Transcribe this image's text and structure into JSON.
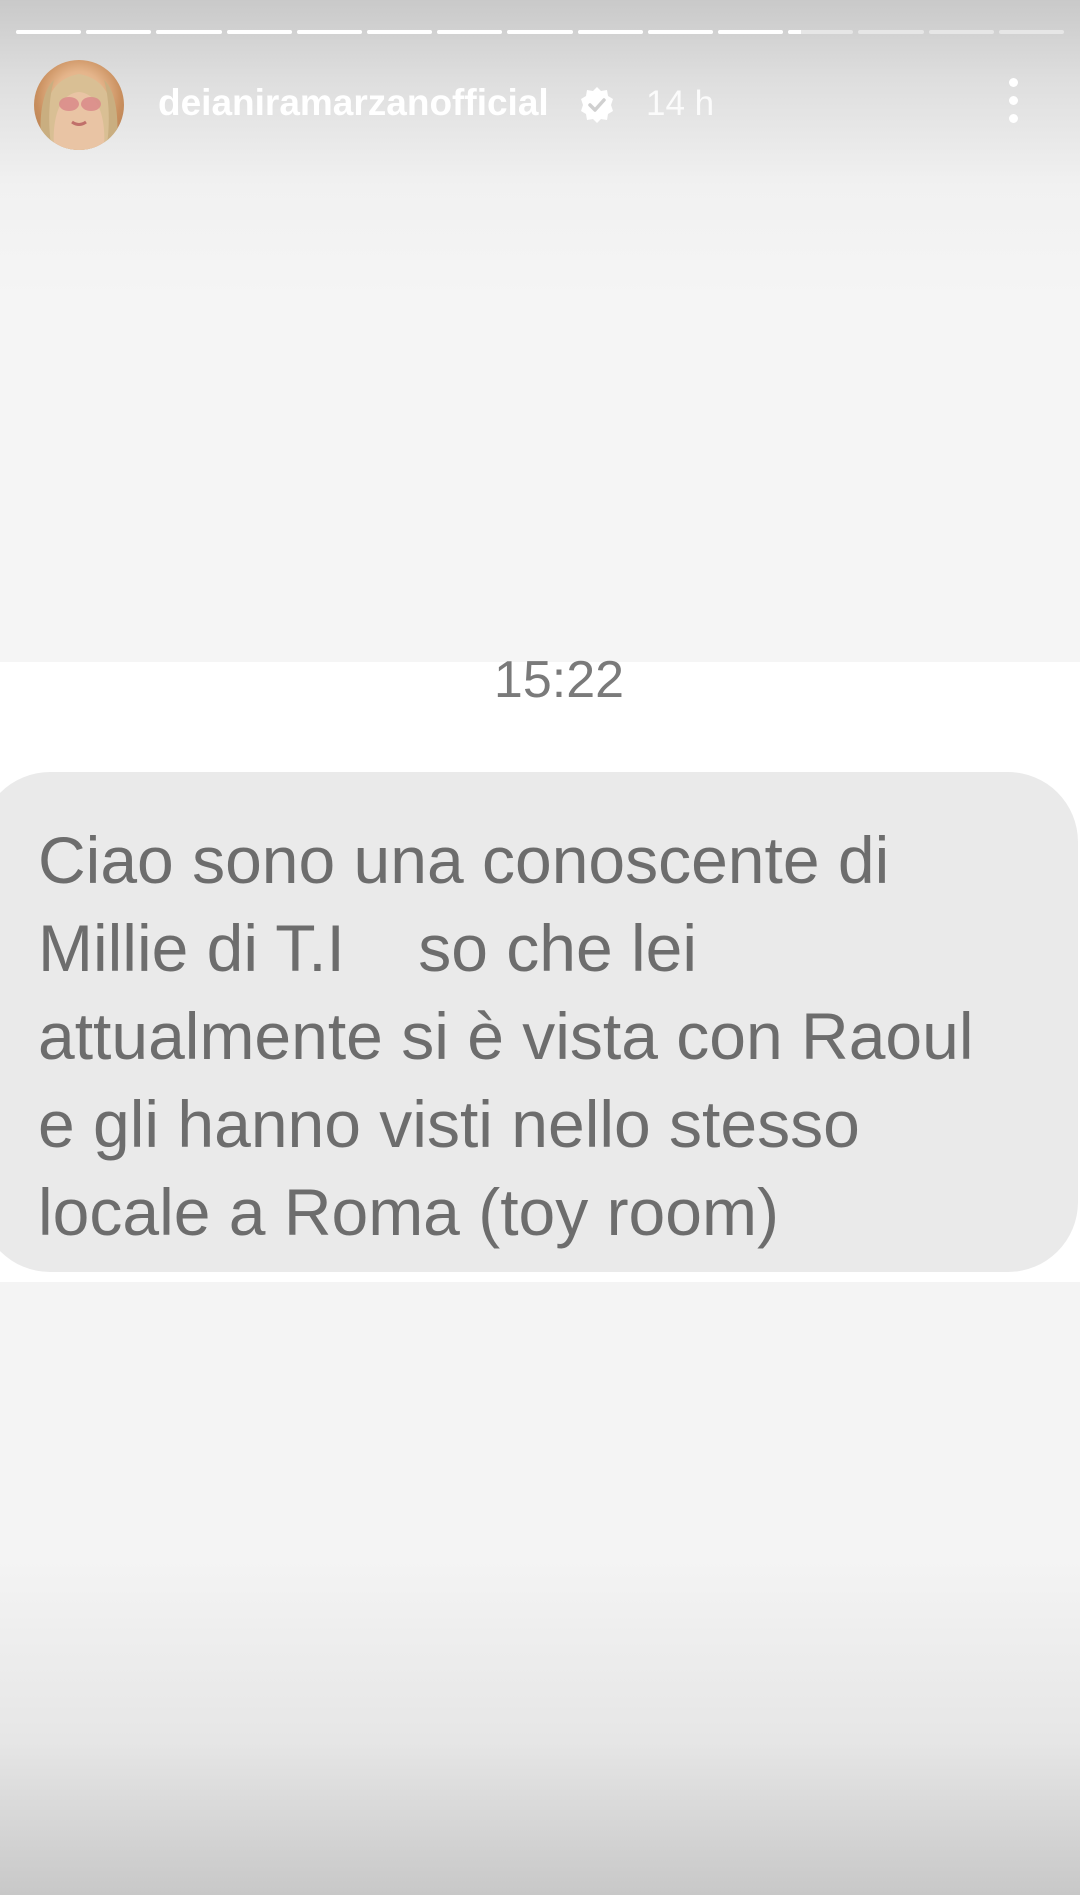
{
  "story": {
    "progress": {
      "segments": [
        {
          "filled": 1
        },
        {
          "filled": 1
        },
        {
          "filled": 1
        },
        {
          "filled": 1
        },
        {
          "filled": 1
        },
        {
          "filled": 1
        },
        {
          "filled": 1
        },
        {
          "filled": 1
        },
        {
          "filled": 1
        },
        {
          "filled": 1
        },
        {
          "filled": 1
        },
        {
          "filled": 0.2
        },
        {
          "filled": 0
        },
        {
          "filled": 0
        },
        {
          "filled": 0
        }
      ]
    },
    "header": {
      "username": "deianiramarzanofficial",
      "verified_icon": "verified-badge-icon",
      "time_ago": "14 h",
      "more_icon": "more-vertical-icon"
    }
  },
  "message": {
    "time": "15:22",
    "text": "Ciao sono una conoscente di\nMillie di T.I    so che lei\nattualmente si è vista con Raoul\ne gli hanno visti nello stesso\nlocale a Roma (toy room)"
  },
  "colors": {
    "bubble": "#eaeaea",
    "text": "#6d6d6d",
    "time": "#7a7a7a"
  }
}
